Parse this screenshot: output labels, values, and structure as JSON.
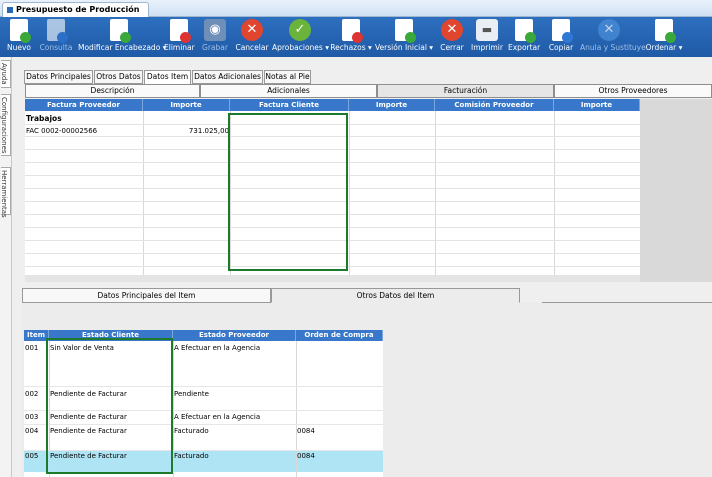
{
  "window": {
    "title": "Presupuesto de Producción"
  },
  "toolbar": {
    "buttons": [
      {
        "label": "Nuevo",
        "icon": "new-document-icon"
      },
      {
        "label": "Consulta",
        "icon": "query-icon",
        "disabled": true
      },
      {
        "label": "Modificar Encabezado ▾",
        "icon": "edit-header-icon"
      },
      {
        "label": "Eliminar",
        "icon": "delete-icon"
      },
      {
        "label": "Grabar",
        "icon": "save-icon",
        "disabled": true
      },
      {
        "label": "Cancelar",
        "icon": "cancel-icon"
      },
      {
        "label": "Aprobaciones ▾",
        "icon": "approvals-icon"
      },
      {
        "label": "Rechazos ▾",
        "icon": "rejections-icon"
      },
      {
        "label": "Versión Inicial ▾",
        "icon": "initial-version-icon"
      },
      {
        "label": "Cerrar",
        "icon": "close-icon"
      },
      {
        "label": "Imprimir",
        "icon": "printer-icon"
      },
      {
        "label": "Exportar",
        "icon": "export-icon"
      },
      {
        "label": "Copiar",
        "icon": "copy-icon"
      },
      {
        "label": "Anula y Sustituye",
        "icon": "cancel-replace-icon",
        "disabled": true
      },
      {
        "label": "Ordenar ▾",
        "icon": "order-icon"
      }
    ]
  },
  "sidebar": {
    "tabs": [
      "Ayuda",
      "Configuraciones",
      "Herramientas"
    ]
  },
  "main_tabs": [
    "Datos Principales",
    "Otros Datos",
    "Datos Item",
    "Datos Adicionales",
    "Notas al Pie"
  ],
  "sub_tabs": [
    "Descripción",
    "Adicionales",
    "Facturación",
    "Otros Proveedores"
  ],
  "billing_grid": {
    "columns": [
      "Factura Proveedor",
      "Importe",
      "Factura Cliente",
      "Importe",
      "Comisión Proveedor",
      "Importe"
    ],
    "group_label": "Trabajos",
    "rows": [
      {
        "factura_proveedor": "FAC 0002-00002566",
        "importe": "731.025,00"
      }
    ]
  },
  "detail_tabs": [
    "Datos Principales del Item",
    "Otros Datos del Item"
  ],
  "items_grid": {
    "columns": [
      "Item",
      "Estado Cliente",
      "Estado Proveedor",
      "Orden de Compra"
    ],
    "rows": [
      {
        "item": "001",
        "estado_cliente": "Sin Valor de Venta",
        "estado_proveedor": "A Efectuar en la Agencia",
        "orden": ""
      },
      {
        "item": "002",
        "estado_cliente": "Pendiente de Facturar",
        "estado_proveedor": "Pendiente",
        "orden": ""
      },
      {
        "item": "003",
        "estado_cliente": "Pendiente de Facturar",
        "estado_proveedor": "A Efectuar en la Agencia",
        "orden": ""
      },
      {
        "item": "004",
        "estado_cliente": "Pendiente de Facturar",
        "estado_proveedor": "Facturado",
        "orden": "0084"
      },
      {
        "item": "005",
        "estado_cliente": "Pendiente de Facturar",
        "estado_proveedor": "Facturado",
        "orden": "0084"
      }
    ]
  },
  "colors": {
    "header_blue": "#3877c9",
    "toolbar_blue": "#2566b3",
    "selection_green": "#1d7a2a",
    "selected_row": "#aee4f3"
  }
}
